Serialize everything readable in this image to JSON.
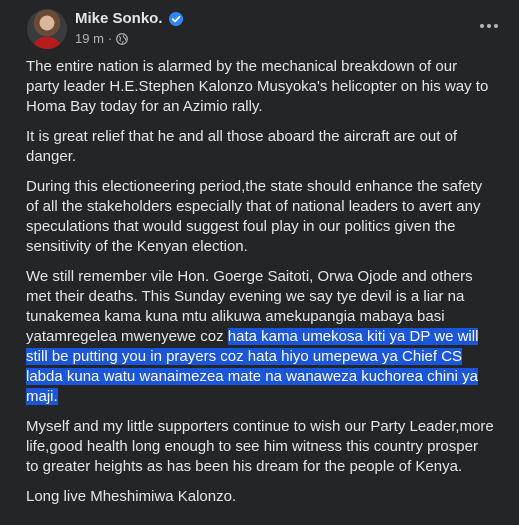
{
  "post": {
    "author": "Mike Sonko.",
    "time": "19 m",
    "meta_separator": "·",
    "paragraphs": {
      "p1": "The entire nation is alarmed by the mechanical breakdown of our party leader H.E.Stephen Kalonzo Musyoka's helicopter on his way to Homa Bay today for an Azimio rally.",
      "p2": "It is great relief that he and all those aboard the aircraft are out of danger.",
      "p3": "During this electioneering period,the state should enhance the safety of all the stakeholders especially that of national leaders to avert any speculations that would suggest foul play in our politics given the sensitivity of the Kenyan election.",
      "p4_plain": "We still remember vile Hon. Goerge Saitoti, Orwa Ojode and others met their deaths. This Sunday evening we say tye devil is a liar na tunakemea kama kuna mtu alikuwa amekupangia mabaya basi yatamregelea mwenyewe coz ",
      "p4_highlight": "hata kama umekosa kiti ya DP we will still be putting you in prayers coz hata hiyo umepewa ya Chief CS labda kuna watu wanaimezea mate na wanaweza kuchorea chini ya maji.",
      "p5": "Myself and my little supporters continue to wish our Party Leader,more life,good health long enough to see him witness this country prosper to greater heights as has been his dream for the people of Kenya.",
      "p6": "Long live Mheshimiwa Kalonzo."
    }
  },
  "icons": {
    "verified": "verified-badge-icon",
    "audience": "globe-icon",
    "more": "more-options-icon"
  },
  "colors": {
    "background": "#242526",
    "text": "#e4e6eb",
    "secondary_text": "#b0b3b8",
    "verified": "#2d88ff",
    "highlight": "#1a56db"
  }
}
